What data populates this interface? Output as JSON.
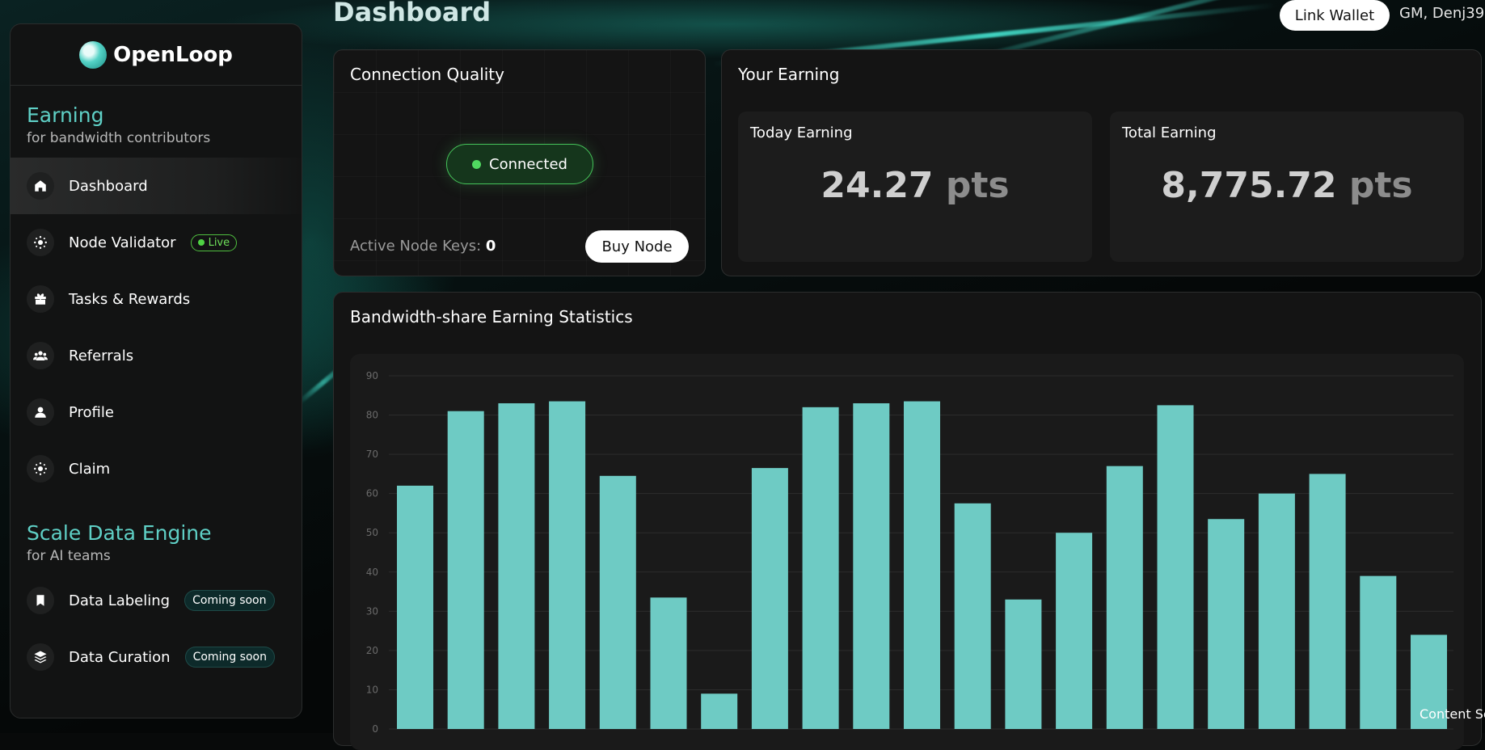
{
  "header": {
    "title": "Dashboard",
    "link_wallet_label": "Link Wallet",
    "greeting": "GM, Denj39"
  },
  "sidebar": {
    "brand": "OpenLoop",
    "sections": [
      {
        "title": "Earning",
        "subtitle": "for bandwidth contributors",
        "items": [
          {
            "label": "Dashboard",
            "icon": "home-icon",
            "active": true
          },
          {
            "label": "Node Validator",
            "icon": "node-icon",
            "badge": "Live"
          },
          {
            "label": "Tasks & Rewards",
            "icon": "gift-icon"
          },
          {
            "label": "Referrals",
            "icon": "users-icon"
          },
          {
            "label": "Profile",
            "icon": "user-icon"
          },
          {
            "label": "Claim",
            "icon": "claim-icon"
          }
        ]
      },
      {
        "title": "Scale Data Engine",
        "subtitle": "for AI teams",
        "items": [
          {
            "label": "Data Labeling",
            "icon": "bookmark-icon",
            "badge": "Coming soon"
          },
          {
            "label": "Data Curation",
            "icon": "layers-icon",
            "badge": "Coming soon"
          }
        ]
      }
    ]
  },
  "connection": {
    "title": "Connection Quality",
    "status": "Connected",
    "active_keys_label": "Active Node Keys:",
    "active_keys_value": "0",
    "buy_node_label": "Buy Node"
  },
  "earning": {
    "title": "Your Earning",
    "today_label": "Today Earning",
    "today_value": "24.27",
    "total_label": "Total Earning",
    "total_value": "8,775.72",
    "unit": "pts"
  },
  "stats": {
    "title": "Bandwidth-share Earning Statistics"
  },
  "footer_text": "Content Sc",
  "colors": {
    "accent": "#5fd0c6",
    "bar": "#6ecbc4",
    "live_green": "#4fd244"
  },
  "chart_data": {
    "type": "bar",
    "title": "Bandwidth-share Earning Statistics",
    "ylim": [
      0,
      90
    ],
    "yticks": [
      0,
      10,
      20,
      30,
      40,
      50,
      60,
      70,
      80,
      90
    ],
    "grid": true,
    "values": [
      62,
      81,
      83,
      83.5,
      64.5,
      33.5,
      9,
      66.5,
      82,
      83,
      83.5,
      57.5,
      33,
      50,
      67,
      82.5,
      53.5,
      60,
      65,
      39,
      24
    ]
  }
}
